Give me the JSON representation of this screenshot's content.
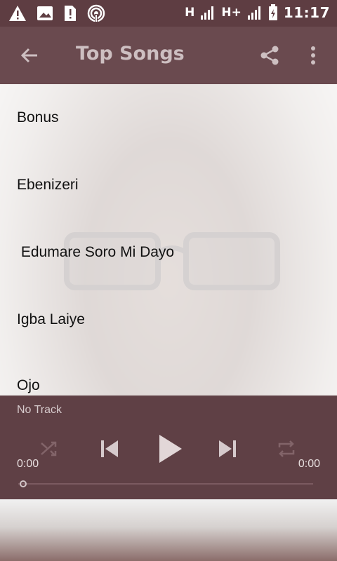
{
  "status_bar": {
    "time": "11:17",
    "network_1": "H",
    "network_2": "H+",
    "icons": [
      "warning-icon",
      "image-icon",
      "sim-alert-icon",
      "hotspot-icon",
      "signal-icon",
      "battery-icon"
    ]
  },
  "app_bar": {
    "title": "Top Songs",
    "icons": [
      "back-arrow-icon",
      "share-icon",
      "more-vert-icon"
    ]
  },
  "songs": [
    {
      "title": "Bonus"
    },
    {
      "title": "Ebenizeri"
    },
    {
      "title": " Edumare Soro Mi Dayo"
    },
    {
      "title": "Igba Laiye"
    },
    {
      "title": "Ojo"
    }
  ],
  "player": {
    "track_name": "No Track",
    "current_time": "0:00",
    "total_time": "0:00",
    "progress_fraction": 0.0,
    "icons": [
      "shuffle-icon",
      "previous-icon",
      "play-icon",
      "next-icon",
      "repeat-icon"
    ]
  },
  "colors": {
    "status_bar": "#5e3d42",
    "app_bar": "#6a4a4f",
    "player": "#5f4045",
    "accent_text": "#cdbfc1"
  }
}
